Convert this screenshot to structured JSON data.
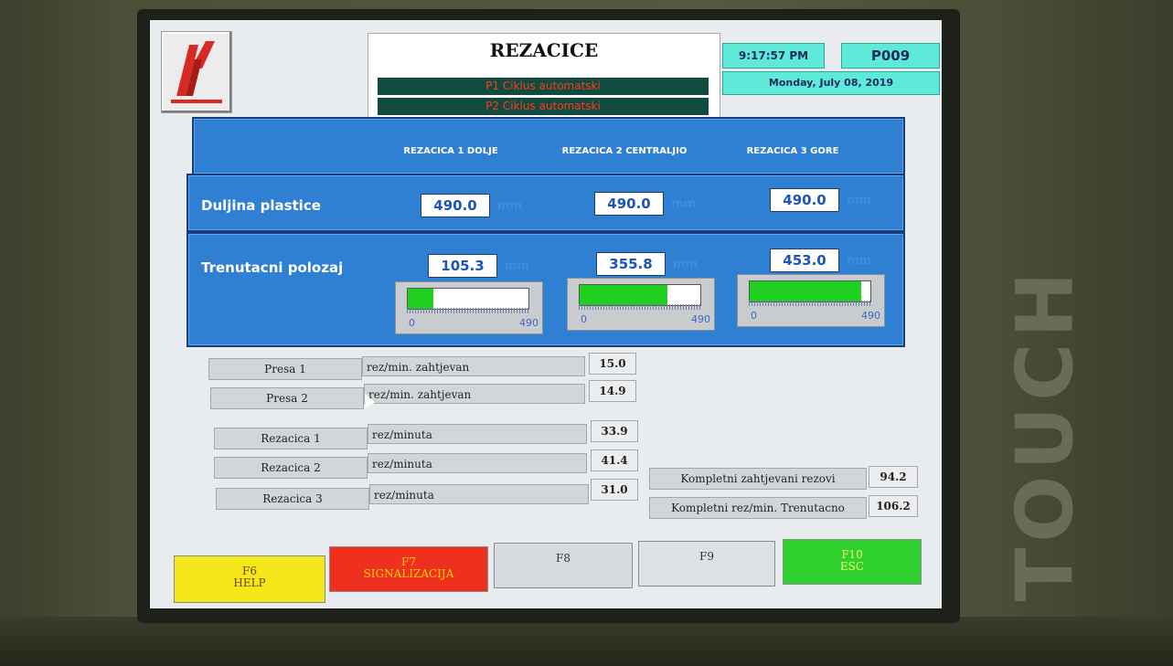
{
  "header": {
    "title": "REZACICE",
    "cycle_p1": "P1 Ciklus automatski",
    "cycle_p2": "P2 Ciklus automatski",
    "time": "9:17:57 PM",
    "page": "P009",
    "date": "Monday, July 08, 2019"
  },
  "columns": {
    "c1": "REZACICA 1 DOLJE",
    "c2": "REZACICA 2 CENTRALJIO",
    "c3": "REZACICA 3 GORE"
  },
  "length_row": {
    "label": "Duljina plastice",
    "values": [
      "490.0",
      "490.0",
      "490.0"
    ],
    "unit": "mm"
  },
  "position_row": {
    "label": "Trenutacni polozaj",
    "values": [
      "105.3",
      "355.8",
      "453.0"
    ],
    "unit": "mm",
    "gauge_min": "0",
    "gauge_max": "490",
    "gauge_fill_fraction": [
      0.215,
      0.726,
      0.924
    ]
  },
  "presses": [
    {
      "name": "Presa 1",
      "desc": "rez/min. zahtjevan",
      "value": "15.0"
    },
    {
      "name": "Presa 2",
      "desc": "rez/min. zahtjevan",
      "value": "14.9"
    }
  ],
  "cutters": [
    {
      "name": "Rezacica 1",
      "desc": "rez/minuta",
      "value": "33.9"
    },
    {
      "name": "Rezacica 2",
      "desc": "rez/minuta",
      "value": "41.4"
    },
    {
      "name": "Rezacica 3",
      "desc": "rez/minuta",
      "value": "31.0"
    }
  ],
  "totals": [
    {
      "label": "Kompletni zahtjevani rezovi",
      "value": "94.2"
    },
    {
      "label": "Kompletni rez/min. Trenutacno",
      "value": "106.2"
    }
  ],
  "fkeys": {
    "f6": "F6",
    "f6_sub": "HELP",
    "f7": "F7",
    "f7_sub": "SIGNALIZACIJA",
    "f8": "F8",
    "f9": "F9",
    "f10": "F10",
    "f10_sub": "ESC"
  },
  "bezel_label": "TOUCH",
  "colors": {
    "panel_blue": "#2f7fd2",
    "gauge_green": "#20d020",
    "header_cyan": "#5fe9d8",
    "f6_yellow": "#f4e81a",
    "f7_red": "#f0301e",
    "f10_green": "#2fd12f"
  }
}
